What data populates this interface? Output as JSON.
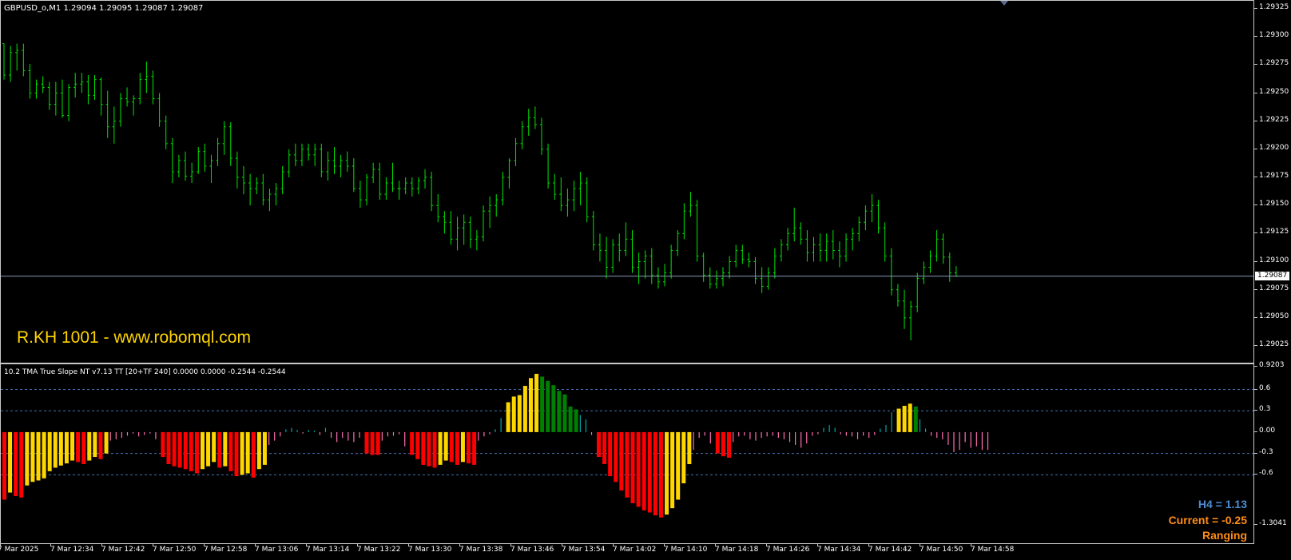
{
  "symbol_header": "GBPUSD_o,M1  1.29094 1.29095 1.29087 1.29087",
  "watermark": "R.KH 1001 - www.robomql.com",
  "indicator_header": "10.2 TMA True Slope NT v7.13 TT [20+TF 240] 0.0000 0.0000 -0.2544 -0.2544",
  "current_price": "1.29087",
  "price_axis": [
    "1.29325",
    "1.29300",
    "1.29275",
    "1.29250",
    "1.29225",
    "1.29200",
    "1.29175",
    "1.29150",
    "1.29125",
    "1.29100",
    "1.29075",
    "1.29050",
    "1.29025"
  ],
  "indicator_axis": [
    "0.9203",
    "0.6",
    "0.3",
    "0.00",
    "-0.3",
    "-0.6",
    "-1.3041"
  ],
  "time_axis": [
    "7 Mar 2025",
    "7 Mar 12:34",
    "7 Mar 12:42",
    "7 Mar 12:50",
    "7 Mar 12:58",
    "7 Mar 13:06",
    "7 Mar 13:14",
    "7 Mar 13:22",
    "7 Mar 13:30",
    "7 Mar 13:38",
    "7 Mar 13:46",
    "7 Mar 13:54",
    "7 Mar 14:02",
    "7 Mar 14:10",
    "7 Mar 14:18",
    "7 Mar 14:26",
    "7 Mar 14:34",
    "7 Mar 14:42",
    "7 Mar 14:50",
    "7 Mar 14:58"
  ],
  "info": {
    "h4": "H4 = 1.13",
    "current": "Current = -0.25",
    "state": "Ranging"
  },
  "colors": {
    "bar": "#00e600",
    "price_line": "#8a9bb8",
    "up_strong": "#ffd700",
    "up_weak": "#008000",
    "down_strong": "#ff0000",
    "down_weak": "#ffd700",
    "flat_neg": "#ff6eb4",
    "flat_pos": "#00a8a8",
    "level": "#4a6fb3"
  },
  "chart_data": {
    "type": "bar",
    "title": "",
    "price_series": {
      "ohlc": [
        [
          1.29294,
          1.29294,
          1.29262,
          1.29266
        ],
        [
          1.29266,
          1.29292,
          1.2926,
          1.29286
        ],
        [
          1.29286,
          1.29294,
          1.2927,
          1.29288
        ],
        [
          1.29288,
          1.29294,
          1.29265,
          1.2927
        ],
        [
          1.2927,
          1.29276,
          1.29245,
          1.2925
        ],
        [
          1.2925,
          1.29262,
          1.29245,
          1.29258
        ],
        [
          1.29258,
          1.29265,
          1.2925,
          1.29255
        ],
        [
          1.29255,
          1.2926,
          1.29235,
          1.2924
        ],
        [
          1.2924,
          1.2926,
          1.2923,
          1.2925
        ],
        [
          1.2925,
          1.29262,
          1.29228,
          1.2923
        ],
        [
          1.2923,
          1.29258,
          1.29225,
          1.29255
        ],
        [
          1.29255,
          1.29268,
          1.29246,
          1.29258
        ],
        [
          1.29258,
          1.29268,
          1.2925,
          1.2926
        ],
        [
          1.2926,
          1.29266,
          1.2924,
          1.29248
        ],
        [
          1.29248,
          1.29266,
          1.29244,
          1.29262
        ],
        [
          1.29262,
          1.29264,
          1.2923,
          1.2924
        ],
        [
          1.2924,
          1.29252,
          1.2921,
          1.2922
        ],
        [
          1.2922,
          1.29238,
          1.29205,
          1.29225
        ],
        [
          1.29225,
          1.2925,
          1.2922,
          1.29245
        ],
        [
          1.29245,
          1.29255,
          1.29238,
          1.29242
        ],
        [
          1.29242,
          1.29248,
          1.2923,
          1.29245
        ],
        [
          1.29245,
          1.29268,
          1.2924,
          1.29262
        ],
        [
          1.29262,
          1.29278,
          1.2925,
          1.29265
        ],
        [
          1.29265,
          1.2927,
          1.2924,
          1.29245
        ],
        [
          1.29245,
          1.2925,
          1.2922,
          1.29225
        ],
        [
          1.29225,
          1.2923,
          1.292,
          1.29205
        ],
        [
          1.29205,
          1.2921,
          1.2917,
          1.2918
        ],
        [
          1.2918,
          1.29195,
          1.29175,
          1.2919
        ],
        [
          1.2919,
          1.29198,
          1.29172,
          1.29176
        ],
        [
          1.29176,
          1.29188,
          1.2917,
          1.2918
        ],
        [
          1.2918,
          1.29202,
          1.29178,
          1.29198
        ],
        [
          1.29198,
          1.29205,
          1.2918,
          1.29185
        ],
        [
          1.29185,
          1.29195,
          1.2917,
          1.2919
        ],
        [
          1.2919,
          1.2921,
          1.29185,
          1.29205
        ],
        [
          1.29205,
          1.29225,
          1.29195,
          1.2922
        ],
        [
          1.2922,
          1.29224,
          1.29185,
          1.29192
        ],
        [
          1.29192,
          1.29198,
          1.29165,
          1.29175
        ],
        [
          1.29175,
          1.29185,
          1.2916,
          1.2917
        ],
        [
          1.2917,
          1.29178,
          1.2915,
          1.29165
        ],
        [
          1.29165,
          1.29175,
          1.2916,
          1.2917
        ],
        [
          1.2917,
          1.29178,
          1.2915,
          1.29155
        ],
        [
          1.29155,
          1.29165,
          1.29145,
          1.2916
        ],
        [
          1.2916,
          1.2917,
          1.2915,
          1.29165
        ],
        [
          1.29165,
          1.29185,
          1.2916,
          1.2918
        ],
        [
          1.2918,
          1.292,
          1.29175,
          1.29195
        ],
        [
          1.29195,
          1.29205,
          1.29185,
          1.2919
        ],
        [
          1.2919,
          1.29205,
          1.29185,
          1.292
        ],
        [
          1.292,
          1.29205,
          1.2919,
          1.29195
        ],
        [
          1.29195,
          1.29205,
          1.29185,
          1.292
        ],
        [
          1.292,
          1.29205,
          1.29175,
          1.2918
        ],
        [
          1.2918,
          1.29198,
          1.29172,
          1.2919
        ],
        [
          1.2919,
          1.29202,
          1.29178,
          1.29185
        ],
        [
          1.29185,
          1.29195,
          1.29175,
          1.2919
        ],
        [
          1.2919,
          1.29198,
          1.2918,
          1.29185
        ],
        [
          1.29185,
          1.29192,
          1.29162,
          1.29165
        ],
        [
          1.29165,
          1.29172,
          1.29148,
          1.29155
        ],
        [
          1.29155,
          1.29178,
          1.2915,
          1.29175
        ],
        [
          1.29175,
          1.29188,
          1.2917,
          1.29182
        ],
        [
          1.29182,
          1.29188,
          1.29155,
          1.2916
        ],
        [
          1.2916,
          1.29175,
          1.29155,
          1.2917
        ],
        [
          1.2917,
          1.29188,
          1.29162,
          1.29165
        ],
        [
          1.29165,
          1.29172,
          1.29155,
          1.29165
        ],
        [
          1.29165,
          1.29175,
          1.2916,
          1.2917
        ],
        [
          1.2917,
          1.29175,
          1.29158,
          1.29165
        ],
        [
          1.29165,
          1.29175,
          1.2916,
          1.29172
        ],
        [
          1.29172,
          1.29182,
          1.29165,
          1.29175
        ],
        [
          1.29175,
          1.2918,
          1.29145,
          1.2915
        ],
        [
          1.2915,
          1.2916,
          1.29135,
          1.2914
        ],
        [
          1.2914,
          1.29145,
          1.29125,
          1.29135
        ],
        [
          1.29135,
          1.29145,
          1.29115,
          1.2912
        ],
        [
          1.2912,
          1.2914,
          1.2911,
          1.2913
        ],
        [
          1.2913,
          1.29142,
          1.29115,
          1.29135
        ],
        [
          1.29135,
          1.2914,
          1.29112,
          1.2912
        ],
        [
          1.2912,
          1.29128,
          1.2911,
          1.29122
        ],
        [
          1.29122,
          1.2915,
          1.29118,
          1.29145
        ],
        [
          1.29145,
          1.29158,
          1.2913,
          1.2915
        ],
        [
          1.2915,
          1.2916,
          1.2914,
          1.29155
        ],
        [
          1.29155,
          1.2918,
          1.2915,
          1.29175
        ],
        [
          1.29175,
          1.29192,
          1.29165,
          1.2919
        ],
        [
          1.2919,
          1.2921,
          1.29185,
          1.29205
        ],
        [
          1.29205,
          1.29225,
          1.292,
          1.2922
        ],
        [
          1.2922,
          1.29236,
          1.29212,
          1.29228
        ],
        [
          1.29228,
          1.29238,
          1.29218,
          1.29222
        ],
        [
          1.29222,
          1.29228,
          1.29195,
          1.292
        ],
        [
          1.292,
          1.29205,
          1.29165,
          1.2917
        ],
        [
          1.2917,
          1.29178,
          1.29155,
          1.2916
        ],
        [
          1.2916,
          1.29175,
          1.29145,
          1.2915
        ],
        [
          1.2915,
          1.29165,
          1.2914,
          1.29155
        ],
        [
          1.29155,
          1.29172,
          1.29145,
          1.29165
        ],
        [
          1.29165,
          1.2918,
          1.2915,
          1.2917
        ],
        [
          1.2917,
          1.29175,
          1.29135,
          1.2914
        ],
        [
          1.2914,
          1.29145,
          1.2911,
          1.29115
        ],
        [
          1.29115,
          1.29125,
          1.291,
          1.2911
        ],
        [
          1.2911,
          1.29122,
          1.29085,
          1.29095
        ],
        [
          1.29095,
          1.2912,
          1.2909,
          1.29115
        ],
        [
          1.29115,
          1.29125,
          1.291,
          1.2911
        ],
        [
          1.2911,
          1.29135,
          1.29105,
          1.2912
        ],
        [
          1.2912,
          1.29128,
          1.2909,
          1.29095
        ],
        [
          1.29095,
          1.29108,
          1.2908,
          1.291
        ],
        [
          1.291,
          1.2911,
          1.29085,
          1.29105
        ],
        [
          1.29105,
          1.29112,
          1.2908,
          1.29088
        ],
        [
          1.29088,
          1.29095,
          1.29076,
          1.29082
        ],
        [
          1.29082,
          1.29098,
          1.29078,
          1.2909
        ],
        [
          1.2909,
          1.29115,
          1.29085,
          1.2911
        ],
        [
          1.2911,
          1.29128,
          1.29105,
          1.29125
        ],
        [
          1.29125,
          1.29152,
          1.2912,
          1.29145
        ],
        [
          1.29145,
          1.29162,
          1.2914,
          1.2915
        ],
        [
          1.2915,
          1.29155,
          1.291,
          1.29105
        ],
        [
          1.29105,
          1.29108,
          1.29082,
          1.29088
        ],
        [
          1.29088,
          1.29095,
          1.29076,
          1.2908
        ],
        [
          1.2908,
          1.29092,
          1.29076,
          1.29085
        ],
        [
          1.29085,
          1.29095,
          1.29078,
          1.2909
        ],
        [
          1.2909,
          1.29105,
          1.29085,
          1.291
        ],
        [
          1.291,
          1.29115,
          1.29095,
          1.2911
        ],
        [
          1.2911,
          1.29115,
          1.29098,
          1.29102
        ],
        [
          1.29102,
          1.29108,
          1.29095,
          1.291
        ],
        [
          1.291,
          1.29104,
          1.2908,
          1.29085
        ],
        [
          1.29085,
          1.29095,
          1.29072,
          1.29078
        ],
        [
          1.29078,
          1.29095,
          1.29075,
          1.2909
        ],
        [
          1.2909,
          1.29112,
          1.29085,
          1.29105
        ],
        [
          1.29105,
          1.2912,
          1.291,
          1.29115
        ],
        [
          1.29115,
          1.2913,
          1.2911,
          1.29125
        ],
        [
          1.29125,
          1.29148,
          1.29118,
          1.2913
        ],
        [
          1.2913,
          1.29135,
          1.29115,
          1.2912
        ],
        [
          1.2912,
          1.29128,
          1.291,
          1.29108
        ],
        [
          1.29108,
          1.29122,
          1.291,
          1.29115
        ],
        [
          1.29115,
          1.29125,
          1.291,
          1.2911
        ],
        [
          1.2911,
          1.29125,
          1.291,
          1.29118
        ],
        [
          1.29118,
          1.29128,
          1.29102,
          1.2911
        ],
        [
          1.2911,
          1.29118,
          1.29095,
          1.29105
        ],
        [
          1.29105,
          1.29125,
          1.291,
          1.2912
        ],
        [
          1.2912,
          1.2913,
          1.2911,
          1.29125
        ],
        [
          1.29125,
          1.2914,
          1.29118,
          1.29135
        ],
        [
          1.29135,
          1.2915,
          1.29128,
          1.29145
        ],
        [
          1.29145,
          1.2916,
          1.29135,
          1.2915
        ],
        [
          1.2915,
          1.29155,
          1.29125,
          1.2913
        ],
        [
          1.2913,
          1.29135,
          1.291,
          1.29105
        ],
        [
          1.29105,
          1.29112,
          1.2907,
          1.29075
        ],
        [
          1.29075,
          1.2908,
          1.2906,
          1.29065
        ],
        [
          1.29065,
          1.29075,
          1.2904,
          1.2905
        ],
        [
          1.2905,
          1.29065,
          1.2903,
          1.2906
        ],
        [
          1.2906,
          1.2909,
          1.29055,
          1.29085
        ],
        [
          1.29085,
          1.291,
          1.2908,
          1.29095
        ],
        [
          1.29095,
          1.2911,
          1.2909,
          1.29105
        ],
        [
          1.29105,
          1.29128,
          1.291,
          1.2912
        ],
        [
          1.2912,
          1.29125,
          1.29098,
          1.29104
        ],
        [
          1.29104,
          1.29108,
          1.29082,
          1.2909
        ],
        [
          1.2909,
          1.29096,
          1.29087,
          1.29087
        ]
      ]
    },
    "indicator_series": {
      "values": [
        -0.95,
        -0.85,
        -0.9,
        -0.92,
        -0.75,
        -0.7,
        -0.68,
        -0.65,
        -0.55,
        -0.5,
        -0.47,
        -0.44,
        -0.4,
        -0.42,
        -0.45,
        -0.4,
        -0.35,
        -0.38,
        -0.3,
        -0.12,
        -0.1,
        -0.08,
        -0.05,
        -0.02,
        -0.06,
        -0.04,
        -0.02,
        -0.1,
        -0.35,
        -0.45,
        -0.48,
        -0.5,
        -0.52,
        -0.55,
        -0.58,
        -0.52,
        -0.48,
        -0.42,
        -0.5,
        -0.48,
        -0.55,
        -0.62,
        -0.6,
        -0.58,
        -0.64,
        -0.52,
        -0.46,
        -0.18,
        -0.12,
        -0.06,
        0.04,
        0.06,
        0.03,
        -0.02,
        0.03,
        0.02,
        -0.04,
        0.06,
        -0.08,
        -0.14,
        -0.08,
        -0.12,
        -0.14,
        -0.08,
        -0.3,
        -0.32,
        -0.32,
        -0.12,
        -0.06,
        -0.05,
        -0.03,
        -0.2,
        -0.32,
        -0.38,
        -0.46,
        -0.48,
        -0.5,
        -0.46,
        -0.4,
        -0.42,
        -0.46,
        -0.42,
        -0.44,
        -0.46,
        -0.12,
        -0.06,
        -0.03,
        0.04,
        0.2,
        0.42,
        0.5,
        0.52,
        0.65,
        0.76,
        0.82,
        0.78,
        0.72,
        0.66,
        0.58,
        0.53,
        0.36,
        0.32,
        0.24,
        0.18,
        -0.04,
        -0.35,
        -0.45,
        -0.62,
        -0.7,
        -0.82,
        -0.92,
        -1.0,
        -1.05,
        -1.1,
        -1.13,
        -1.17,
        -1.2,
        -1.16,
        -1.07,
        -0.95,
        -0.72,
        -0.45,
        -0.25,
        -0.08,
        -0.05,
        -0.16,
        -0.3,
        -0.34,
        -0.36,
        -0.14,
        -0.06,
        -0.05,
        -0.1,
        -0.12,
        -0.08,
        -0.06,
        -0.05,
        -0.08,
        -0.1,
        -0.14,
        -0.18,
        -0.22,
        -0.16,
        -0.05,
        -0.03,
        0.06,
        0.1,
        0.06,
        -0.03,
        -0.05,
        -0.06,
        -0.1,
        -0.05,
        -0.08,
        -0.04,
        0.05,
        0.1,
        0.28,
        0.33,
        0.37,
        0.4,
        0.36,
        0.18,
        0.05,
        -0.05,
        -0.08,
        -0.1,
        -0.18,
        -0.28,
        -0.25,
        -0.14,
        -0.22,
        -0.2,
        -0.25,
        -0.25
      ]
    }
  }
}
